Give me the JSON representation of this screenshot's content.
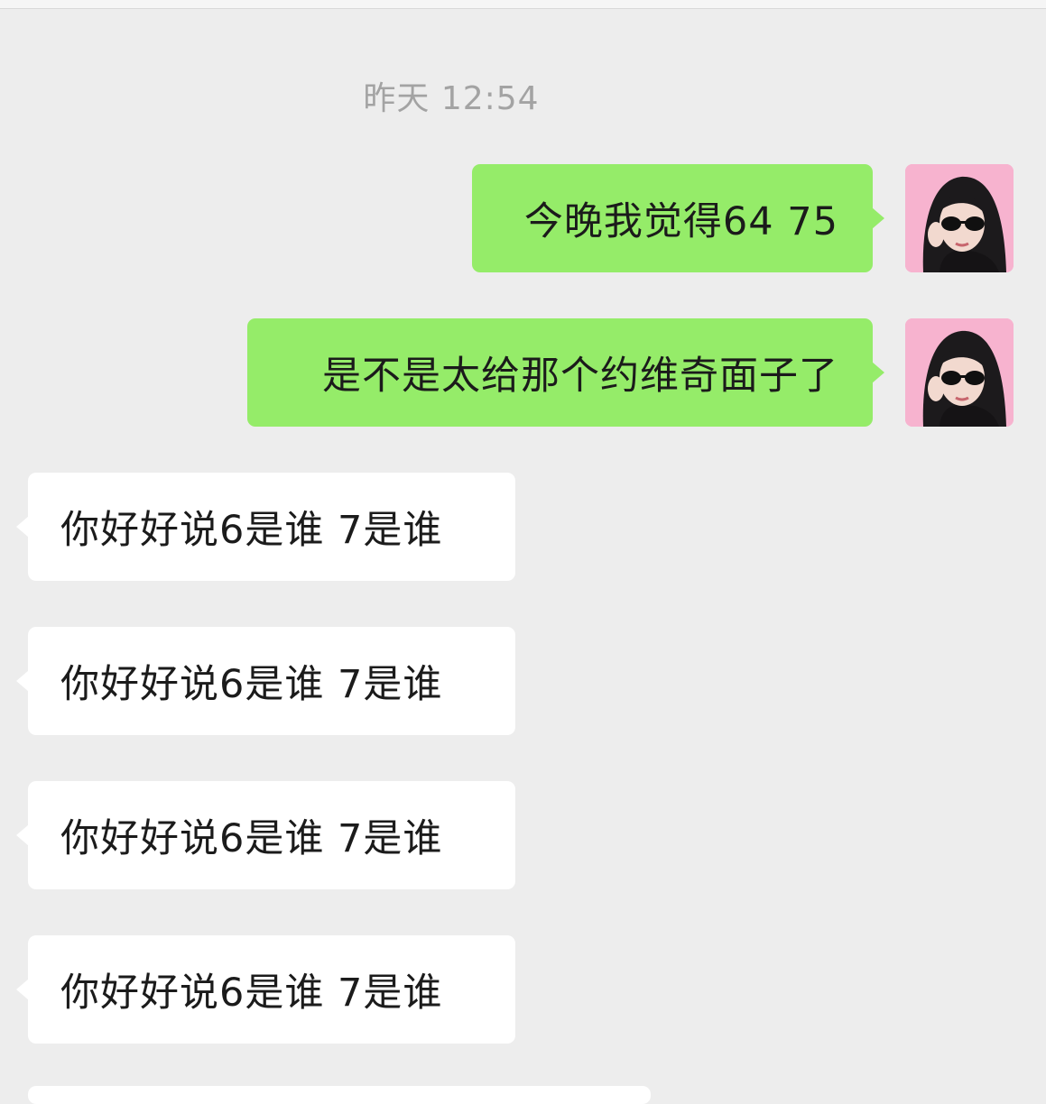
{
  "chat": {
    "timestamp": "昨天 12:54",
    "messages": [
      {
        "direction": "sent",
        "text": "今晚我觉得64 75",
        "avatar_icon": "user-avatar-photo"
      },
      {
        "direction": "sent",
        "text": "是不是太给那个约维奇面子了",
        "avatar_icon": "user-avatar-photo"
      },
      {
        "direction": "received",
        "text": "你好好说6是谁 7是谁"
      },
      {
        "direction": "received",
        "text": "你好好说6是谁 7是谁"
      },
      {
        "direction": "received",
        "text": "你好好说6是谁 7是谁"
      },
      {
        "direction": "received",
        "text": "你好好说6是谁 7是谁"
      }
    ]
  },
  "colors": {
    "background": "#ededed",
    "sent_bubble": "#95ec69",
    "received_bubble": "#ffffff",
    "timestamp_text": "#a3a3a3",
    "message_text": "#1b1b1b"
  }
}
